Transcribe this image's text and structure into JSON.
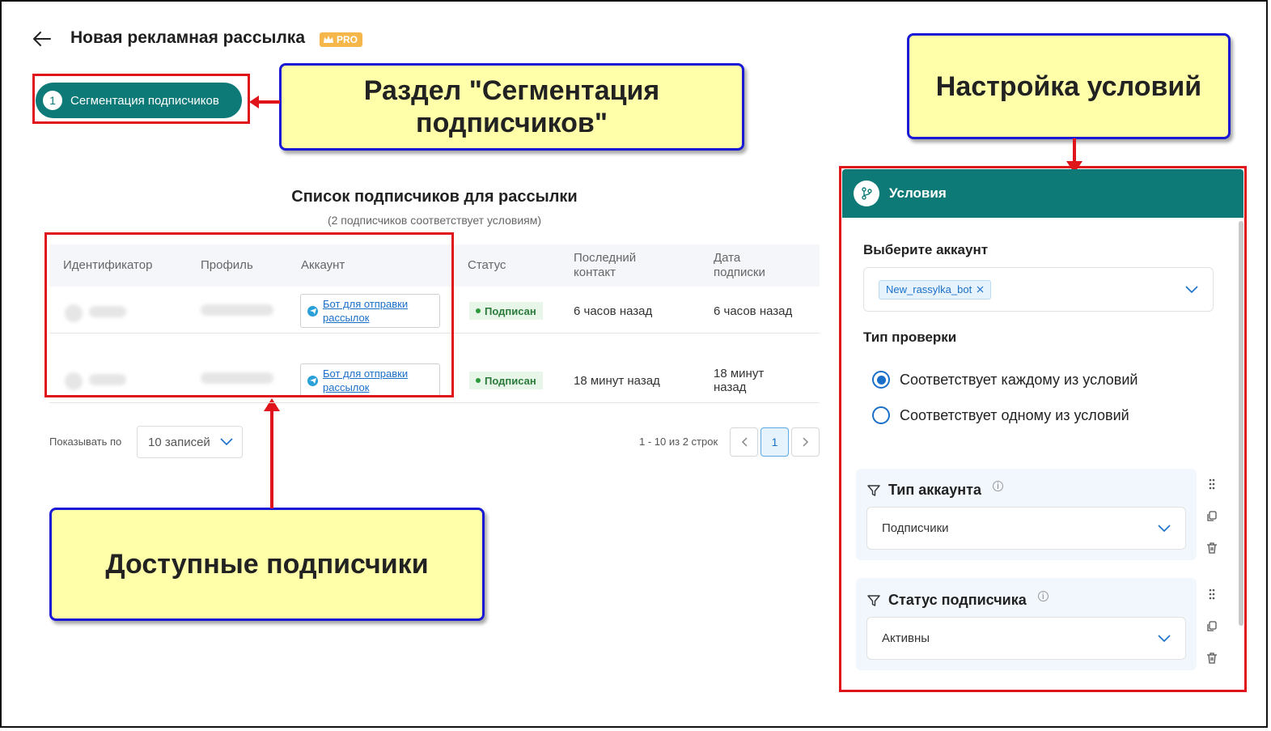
{
  "header": {
    "title": "Новая рекламная рассылка",
    "pro_badge": "PRO"
  },
  "step": {
    "number": "1",
    "label": "Сегментация подписчиков"
  },
  "callouts": {
    "segment": "Раздел \"Сегментация подписчиков\"",
    "conditions": "Настройка условий",
    "subscribers": "Доступные подписчики"
  },
  "list": {
    "title": "Список подписчиков для рассылки",
    "subtitle": "(2 подписчиков соответствует условиям)",
    "columns": [
      "Идентификатор",
      "Профиль",
      "Аккаунт",
      "Статус",
      "Последний контакт",
      "Дата подписки"
    ],
    "rows": [
      {
        "account": "Бот для отправки рассылок",
        "status": "Подписан",
        "last_contact": "6 часов назад",
        "subscribed": "6 часов назад"
      },
      {
        "account": "Бот для отправки рассылок",
        "status": "Подписан",
        "last_contact": "18 минут назад",
        "subscribed": "18 минут назад"
      }
    ]
  },
  "pagination": {
    "show_label": "Показывать по",
    "per_page": "10 записей",
    "range": "1 - 10 из 2 строк",
    "current_page": "1"
  },
  "panel": {
    "title": "Условия",
    "account_label": "Выберите аккаунт",
    "account_chip": "New_rassylka_bot",
    "check_type_label": "Тип проверки",
    "radio_all": "Соответствует каждому из условий",
    "radio_any": "Соответствует одному из условий",
    "conditions": [
      {
        "title": "Тип аккаунта",
        "value": "Подписчики"
      },
      {
        "title": "Статус подписчика",
        "value": "Активны"
      }
    ]
  },
  "colors": {
    "teal": "#0e7a78",
    "highlight_red": "#e0141b",
    "callout_fill": "#ffffaa",
    "callout_border": "#1a1ad6",
    "link_blue": "#1a6fc9"
  }
}
